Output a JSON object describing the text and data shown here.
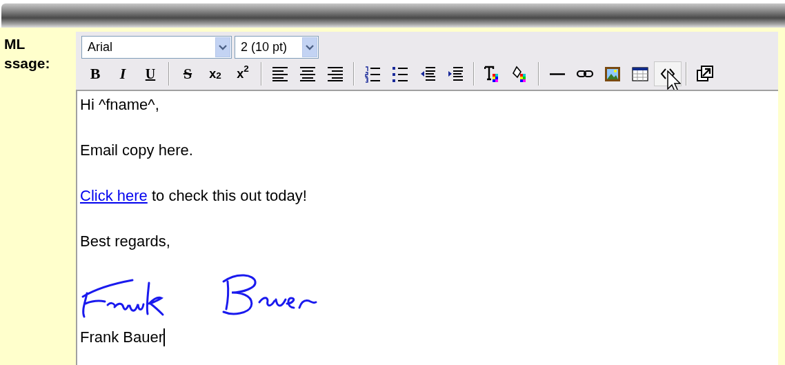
{
  "field_label": [
    "ML",
    "ssage:"
  ],
  "font_select": {
    "value": "Arial"
  },
  "size_select": {
    "value": "2 (10 pt)"
  },
  "toolbar_groups": [
    [
      {
        "kind": "bold",
        "label": "B",
        "hovered": false
      },
      {
        "kind": "italic",
        "label": "I",
        "hovered": false
      },
      {
        "kind": "underline",
        "label": "U",
        "hovered": false
      }
    ],
    [
      {
        "kind": "strike",
        "label": "S",
        "hovered": false
      },
      {
        "kind": "subscript",
        "label": "x$_{2}$",
        "hovered": false
      },
      {
        "kind": "superscript",
        "label": "x$^{2}$",
        "hovered": false
      }
    ],
    [
      {
        "kind": "align-left",
        "hovered": false
      },
      {
        "kind": "align-center",
        "hovered": false
      },
      {
        "kind": "align-right",
        "hovered": false
      }
    ],
    [
      {
        "kind": "ordered-list",
        "hovered": false
      },
      {
        "kind": "bullet-list",
        "hovered": false
      },
      {
        "kind": "outdent",
        "hovered": false
      },
      {
        "kind": "indent",
        "hovered": false
      }
    ],
    [
      {
        "kind": "text-color",
        "hovered": false
      },
      {
        "kind": "fill-color",
        "hovered": false
      }
    ],
    [
      {
        "kind": "rule",
        "hovered": false
      },
      {
        "kind": "link",
        "hovered": false
      },
      {
        "kind": "image",
        "hovered": false
      },
      {
        "kind": "table",
        "hovered": false
      },
      {
        "kind": "source",
        "hovered": true
      }
    ],
    [
      {
        "kind": "popout",
        "hovered": false
      }
    ]
  ],
  "body": [
    {
      "kind": "text",
      "text": "Hi ^fname^,"
    },
    {
      "kind": "text",
      "text": "Email copy here."
    },
    {
      "kind": "link_line",
      "link": "Click here",
      "text": "to check this out today!"
    },
    {
      "kind": "text",
      "text": "Best regards,"
    },
    {
      "kind": "signature"
    },
    {
      "kind": "caret_line",
      "text": "Frank Bauer"
    }
  ]
}
